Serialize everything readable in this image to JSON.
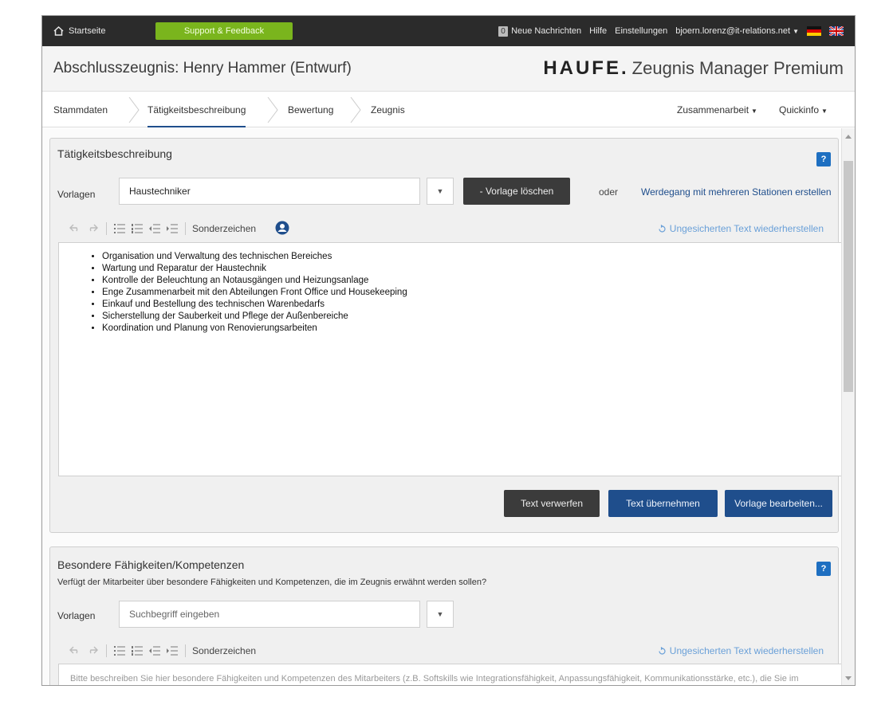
{
  "topbar": {
    "home_label": "Startseite",
    "support_label": "Support & Feedback",
    "messages_count": "0",
    "messages_label": "Neue Nachrichten",
    "help_label": "Hilfe",
    "settings_label": "Einstellungen",
    "user_email": "bjoern.lorenz@it-relations.net",
    "icons": [
      "home-icon",
      "flag-de-icon",
      "flag-uk-icon"
    ]
  },
  "header": {
    "doc_title": "Abschlusszeugnis: Henry Hammer (Entwurf)",
    "brand_name": "HAUFE.",
    "product_name": "Zeugnis Manager Premium"
  },
  "tabs": {
    "items": [
      "Stammdaten",
      "Tätigkeitsbeschreibung",
      "Bewertung",
      "Zeugnis"
    ],
    "active": "Tätigkeitsbeschreibung",
    "collab_label": "Zusammenarbeit",
    "quickinfo_label": "Quickinfo"
  },
  "section1": {
    "title": "Tätigkeitsbeschreibung",
    "help": "?",
    "vorlagen_label": "Vorlagen",
    "vorlagen_value": "Haustechniker",
    "delete_template": "- Vorlage löschen",
    "oder": "oder",
    "career_link": "Werdegang mit mehreren Stationen erstellen",
    "toolbar_special": "Sonderzeichen",
    "restore_label": "Ungesicherten Text wiederherstellen",
    "items": [
      "Organisation und Verwaltung des technischen Bereiches",
      "Wartung und Reparatur der Haustechnik",
      "Kontrolle der Beleuchtung an Notausgängen und Heizungsanlage",
      "Enge Zusammenarbeit mit den Abteilungen Front Office und Housekeeping",
      "Einkauf und Bestellung des technischen Warenbedarfs",
      "Sicherstellung der Sauberkeit und Pflege der Außenbereiche",
      "Koordination und Planung von Renovierungsarbeiten"
    ],
    "discard_label": "Text verwerfen",
    "accept_label": "Text übernehmen",
    "edit_template_label": "Vorlage bearbeiten..."
  },
  "section2": {
    "title": "Besondere Fähigkeiten/Kompetenzen",
    "help": "?",
    "subtitle": "Verfügt der Mitarbeiter über besondere Fähigkeiten und Kompetenzen, die im Zeugnis erwähnt werden sollen?",
    "vorlagen_label": "Vorlagen",
    "search_placeholder": "Suchbegriff eingeben",
    "toolbar_special": "Sonderzeichen",
    "restore_label": "Ungesicherten Text wiederherstellen",
    "editor_placeholder": "Bitte beschreiben Sie hier besondere Fähigkeiten und Kompetenzen des Mitarbeiters (z.B. Softskills wie Integrationsfähigkeit, Anpassungsfähigkeit, Kommunikationsstärke, etc.), die Sie im Arbeitszeugnis dokumentieren wollen."
  },
  "colors": {
    "topbar": "#2b2b2b",
    "support": "#7ab51d",
    "accent": "#1f4e8c",
    "help": "#1e6fc1"
  }
}
